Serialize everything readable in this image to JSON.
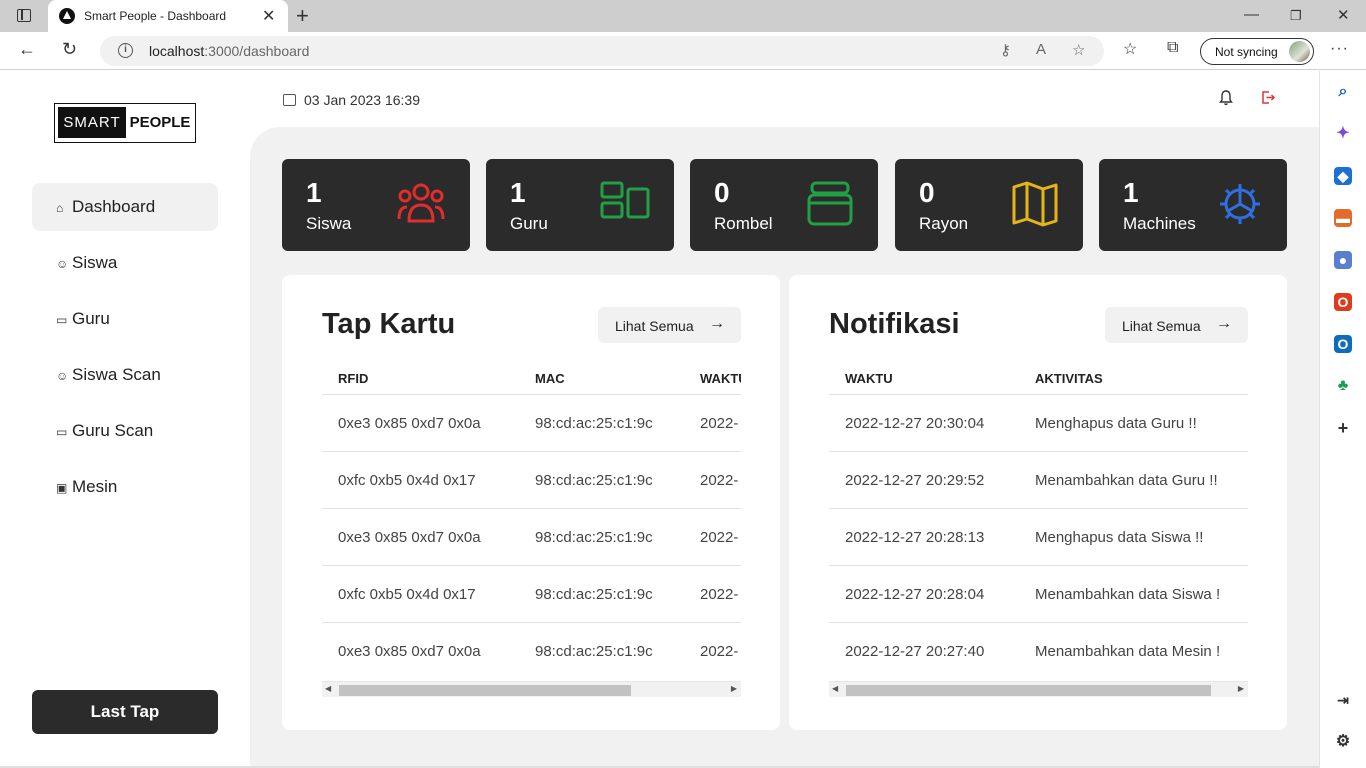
{
  "browser": {
    "tab_title": "Smart People - Dashboard",
    "url_host": "localhost",
    "url_path": ":3000/dashboard",
    "sync_label": "Not syncing"
  },
  "logo": {
    "part1": "SMART",
    "part2": "PEOPLE"
  },
  "sidebar": {
    "items": [
      {
        "label": "Dashboard",
        "icon": "home-icon",
        "active": true
      },
      {
        "label": "Siswa",
        "icon": "users-icon"
      },
      {
        "label": "Guru",
        "icon": "layout-icon"
      },
      {
        "label": "Siswa Scan",
        "icon": "users-icon"
      },
      {
        "label": "Guru Scan",
        "icon": "layout-icon"
      },
      {
        "label": "Mesin",
        "icon": "cpu-icon"
      }
    ],
    "last_tap": "Last Tap"
  },
  "header": {
    "datetime": "03 Jan 2023 16:39"
  },
  "stats": [
    {
      "value": "1",
      "label": "Siswa",
      "icon": "users-icon",
      "color": "#e22d2d"
    },
    {
      "value": "1",
      "label": "Guru",
      "icon": "layout-icon",
      "color": "#22a045"
    },
    {
      "value": "0",
      "label": "Rombel",
      "icon": "archive-icon",
      "color": "#22a045"
    },
    {
      "value": "0",
      "label": "Rayon",
      "icon": "map-icon",
      "color": "#e7b416"
    },
    {
      "value": "1",
      "label": "Machines",
      "icon": "gear-icon",
      "color": "#2f6fe0"
    }
  ],
  "tap_kartu": {
    "title": "Tap Kartu",
    "button": "Lihat Semua",
    "columns": [
      "RFID",
      "MAC",
      "WAKTU"
    ],
    "rows": [
      [
        "0xe3 0x85 0xd7 0x0a",
        "98:cd:ac:25:c1:9c",
        "2022-"
      ],
      [
        "0xfc 0xb5 0x4d 0x17",
        "98:cd:ac:25:c1:9c",
        "2022-"
      ],
      [
        "0xe3 0x85 0xd7 0x0a",
        "98:cd:ac:25:c1:9c",
        "2022-"
      ],
      [
        "0xfc 0xb5 0x4d 0x17",
        "98:cd:ac:25:c1:9c",
        "2022-"
      ],
      [
        "0xe3 0x85 0xd7 0x0a",
        "98:cd:ac:25:c1:9c",
        "2022-"
      ]
    ]
  },
  "notifikasi": {
    "title": "Notifikasi",
    "button": "Lihat Semua",
    "columns": [
      "WAKTU",
      "AKTIVITAS"
    ],
    "rows": [
      [
        "2022-12-27 20:30:04",
        "Menghapus data Guru !!"
      ],
      [
        "2022-12-27 20:29:52",
        "Menambahkan data Guru !!"
      ],
      [
        "2022-12-27 20:28:13",
        "Menghapus data Siswa !!"
      ],
      [
        "2022-12-27 20:28:04",
        "Menambahkan data Siswa !"
      ],
      [
        "2022-12-27 20:27:40",
        "Menambahkan data Mesin !"
      ]
    ]
  }
}
